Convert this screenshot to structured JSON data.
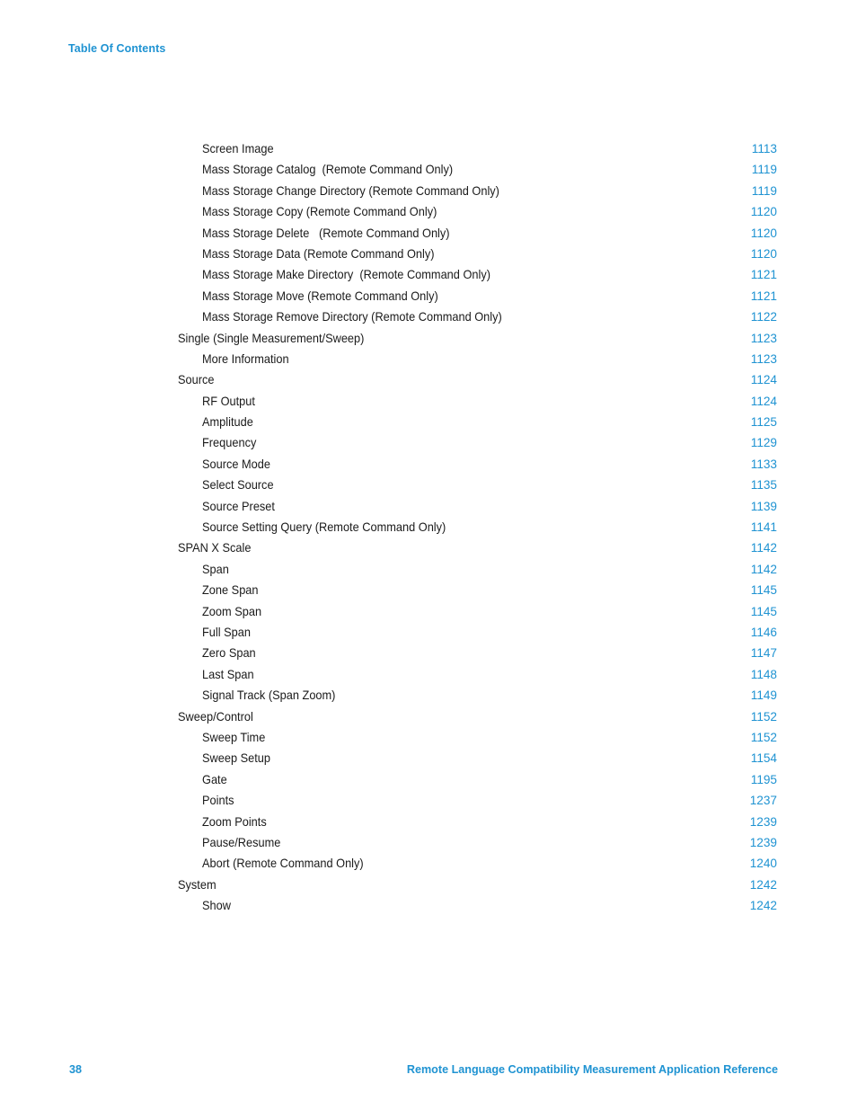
{
  "document": {
    "header_label": "Table Of Contents",
    "accent_color": "#1f93d2",
    "text_color": "#1a1a1a",
    "background_color": "#ffffff"
  },
  "toc": {
    "entries": [
      {
        "level": 2,
        "title": "Screen Image",
        "page": "1113"
      },
      {
        "level": 2,
        "title": "Mass Storage Catalog  (Remote Command Only)",
        "page": "1119"
      },
      {
        "level": 2,
        "title": "Mass Storage Change Directory (Remote Command Only)",
        "page": "1119"
      },
      {
        "level": 2,
        "title": "Mass Storage Copy (Remote Command Only)",
        "page": "1120"
      },
      {
        "level": 2,
        "title": "Mass Storage Delete   (Remote Command Only)",
        "page": "1120"
      },
      {
        "level": 2,
        "title": "Mass Storage Data (Remote Command Only)",
        "page": "1120"
      },
      {
        "level": 2,
        "title": "Mass Storage Make Directory  (Remote Command Only)",
        "page": "1121"
      },
      {
        "level": 2,
        "title": "Mass Storage Move (Remote Command Only)",
        "page": "1121"
      },
      {
        "level": 2,
        "title": "Mass Storage Remove Directory (Remote Command Only)",
        "page": "1122"
      },
      {
        "level": 1,
        "title": "Single (Single Measurement/Sweep)",
        "page": "1123"
      },
      {
        "level": 2,
        "title": "More Information",
        "page": "1123"
      },
      {
        "level": 1,
        "title": "Source",
        "page": "1124"
      },
      {
        "level": 2,
        "title": "RF Output",
        "page": "1124"
      },
      {
        "level": 2,
        "title": "Amplitude",
        "page": "1125"
      },
      {
        "level": 2,
        "title": "Frequency",
        "page": "1129"
      },
      {
        "level": 2,
        "title": "Source Mode",
        "page": "1133"
      },
      {
        "level": 2,
        "title": "Select Source",
        "page": "1135"
      },
      {
        "level": 2,
        "title": "Source Preset",
        "page": "1139"
      },
      {
        "level": 2,
        "title": "Source Setting Query (Remote Command Only)",
        "page": "1141"
      },
      {
        "level": 1,
        "title": "SPAN X Scale",
        "page": "1142"
      },
      {
        "level": 2,
        "title": "Span",
        "page": "1142"
      },
      {
        "level": 2,
        "title": "Zone Span",
        "page": "1145"
      },
      {
        "level": 2,
        "title": "Zoom Span",
        "page": "1145"
      },
      {
        "level": 2,
        "title": "Full Span",
        "page": "1146"
      },
      {
        "level": 2,
        "title": "Zero Span",
        "page": "1147"
      },
      {
        "level": 2,
        "title": "Last Span",
        "page": "1148"
      },
      {
        "level": 2,
        "title": "Signal Track (Span Zoom)",
        "page": "1149"
      },
      {
        "level": 1,
        "title": "Sweep/Control",
        "page": "1152"
      },
      {
        "level": 2,
        "title": "Sweep Time",
        "page": "1152"
      },
      {
        "level": 2,
        "title": "Sweep Setup",
        "page": "1154"
      },
      {
        "level": 2,
        "title": "Gate",
        "page": "1195"
      },
      {
        "level": 2,
        "title": "Points",
        "page": "1237"
      },
      {
        "level": 2,
        "title": "Zoom Points",
        "page": "1239"
      },
      {
        "level": 2,
        "title": "Pause/Resume",
        "page": "1239"
      },
      {
        "level": 2,
        "title": "Abort (Remote Command Only)",
        "page": "1240"
      },
      {
        "level": 1,
        "title": "System",
        "page": "1242"
      },
      {
        "level": 2,
        "title": "Show",
        "page": "1242"
      }
    ]
  },
  "footer": {
    "page_number": "38",
    "title": "Remote Language Compatibility Measurement Application Reference"
  }
}
